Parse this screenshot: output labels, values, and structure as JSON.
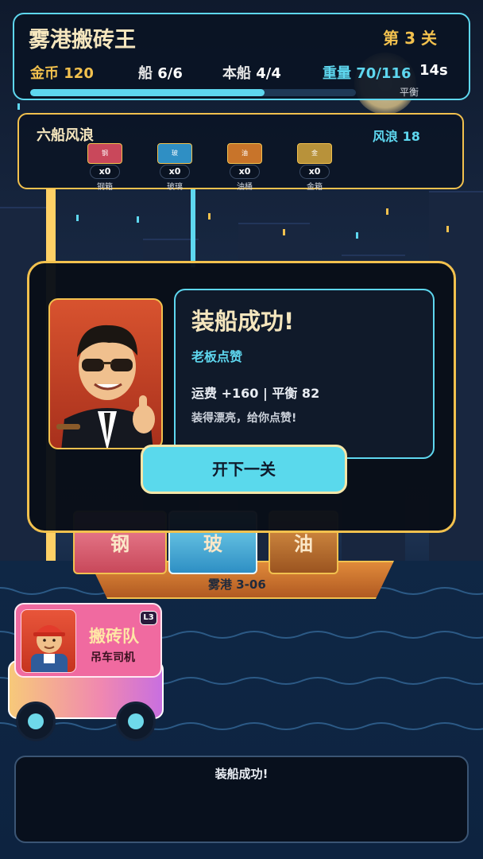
{
  "hud": {
    "title": "雾港搬砖王",
    "level": "第 3 关",
    "gold_label": "金币",
    "gold_value": "120",
    "ships_label": "船",
    "ships_value": "6/6",
    "current_ship_label": "本船",
    "current_ship_value": "4/4",
    "weight_label": "重量",
    "weight_value": "70/116",
    "timer": "14s",
    "balance_label": "平衡",
    "progress_fraction": 0.72
  },
  "wave_panel": {
    "title": "六船风浪",
    "wind": "风浪 18",
    "cargo": [
      {
        "icon_text": "钢",
        "count": "x0",
        "name": "钢箱",
        "color": "#c9485b"
      },
      {
        "icon_text": "玻",
        "count": "x0",
        "name": "玻璃",
        "color": "#2f8fc4"
      },
      {
        "icon_text": "油",
        "count": "x0",
        "name": "油桶",
        "color": "#c8742a"
      },
      {
        "icon_text": "金",
        "count": "x0",
        "name": "金箱",
        "color": "#b8923a"
      }
    ]
  },
  "ship": {
    "name": "雾港 3-06",
    "crates": [
      "钢",
      "玻",
      "油"
    ]
  },
  "crew": {
    "name": "搬砖队",
    "role": "吊车司机",
    "level": "L3"
  },
  "dialog": {
    "title": "装船成功!",
    "subtitle": "老板点赞",
    "stats": "运费 +160  |  平衡 82",
    "quote": "装得漂亮，给你点赞!",
    "next_button": "开下一关"
  },
  "log": {
    "message": "装船成功!"
  },
  "colors": {
    "accent_cyan": "#5ed7ef",
    "accent_gold": "#f2c14e",
    "crew_pink": "#f06aa0"
  }
}
